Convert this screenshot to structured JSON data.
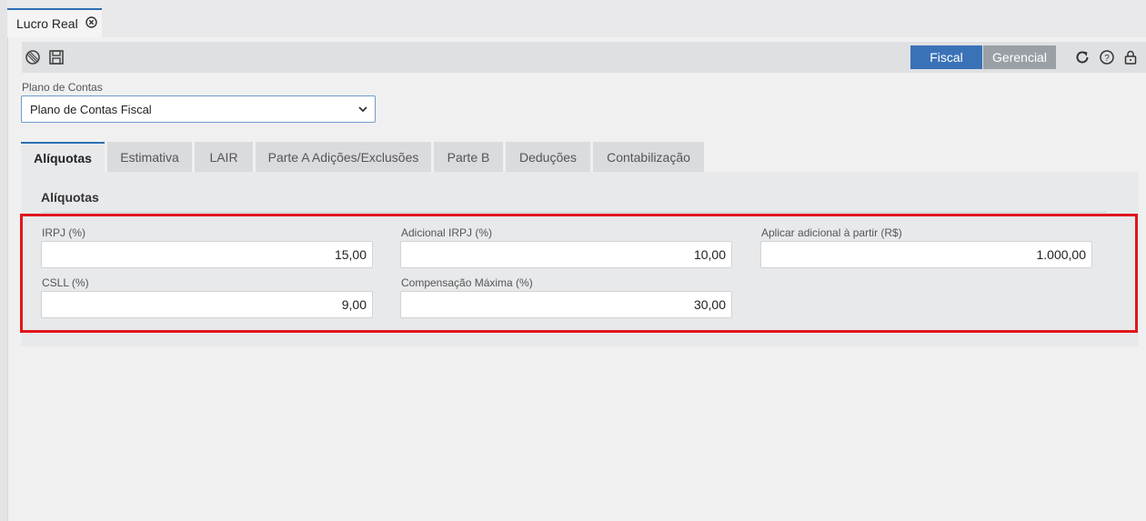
{
  "doc_tab": {
    "title": "Lucro Real",
    "close_icon": "close-circle-icon"
  },
  "toolbar": {
    "icons": [
      "cancel-icon",
      "save-icon"
    ],
    "view_buttons": {
      "fiscal": "Fiscal",
      "gerencial": "Gerencial"
    },
    "right_icons": [
      "refresh-icon",
      "help-icon",
      "lock-icon"
    ],
    "active_view": "Fiscal",
    "accent": "#3a72b8"
  },
  "plano": {
    "label": "Plano de Contas",
    "selected": "Plano de Contas Fiscal"
  },
  "tabs": [
    {
      "label": "Alíquotas",
      "active": true
    },
    {
      "label": "Estimativa"
    },
    {
      "label": "LAIR"
    },
    {
      "label": "Parte A Adições/Exclusões"
    },
    {
      "label": "Parte B"
    },
    {
      "label": "Deduções"
    },
    {
      "label": "Contabilização"
    }
  ],
  "panel": {
    "title": "Alíquotas",
    "fields": {
      "irpj": {
        "label": "IRPJ (%)",
        "value": "15,00"
      },
      "adicional_irpj": {
        "label": "Adicional IRPJ (%)",
        "value": "10,00"
      },
      "aplicar_adicional": {
        "label": "Aplicar adicional à partir (R$)",
        "value": "1.000,00"
      },
      "csll": {
        "label": "CSLL (%)",
        "value": "9,00"
      },
      "compensacao": {
        "label": "Compensação Máxima (%)",
        "value": "30,00"
      }
    },
    "highlight_color": "#e0171b"
  }
}
